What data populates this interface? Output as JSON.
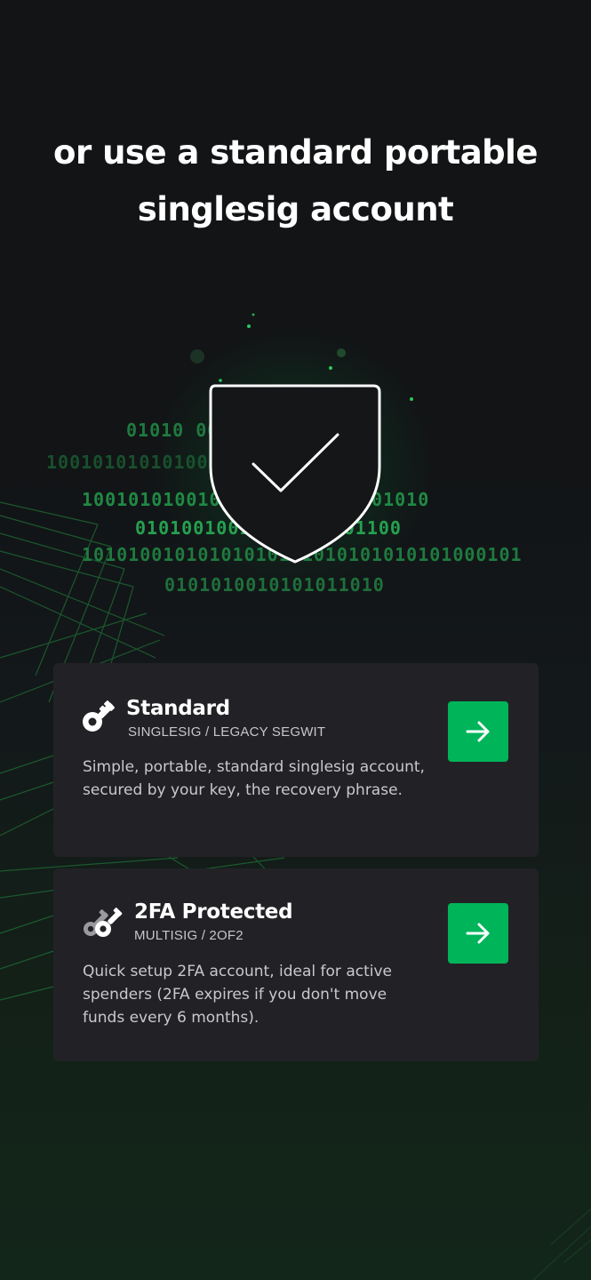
{
  "heading": {
    "line1": "or use a standard portable",
    "line2": "singlesig account"
  },
  "hero": {
    "icon": "shield-check-icon",
    "binary_rows": [
      "01010                    00101010010101",
      "1001010101010010           1010100",
      "1001010100100              1010010101001010",
      "0101001001                 001010101100",
      "10101001010101010101010101010101000101",
      "0101010010101011010"
    ],
    "accent_color": "#00b45a"
  },
  "accounts": [
    {
      "icon": "key-icon",
      "title": "Standard",
      "subtitle": "SINGLESIG / LEGACY SEGWIT",
      "description": "Simple, portable, standard singlesig account, secured by your key, the recovery phrase.",
      "action_icon": "arrow-right-icon"
    },
    {
      "icon": "two-keys-icon",
      "title": "2FA Protected",
      "subtitle": "MULTISIG / 2OF2",
      "description": "Quick setup 2FA account, ideal for active spenders (2FA expires if you don't move funds every 6 months).",
      "action_icon": "arrow-right-icon"
    }
  ]
}
